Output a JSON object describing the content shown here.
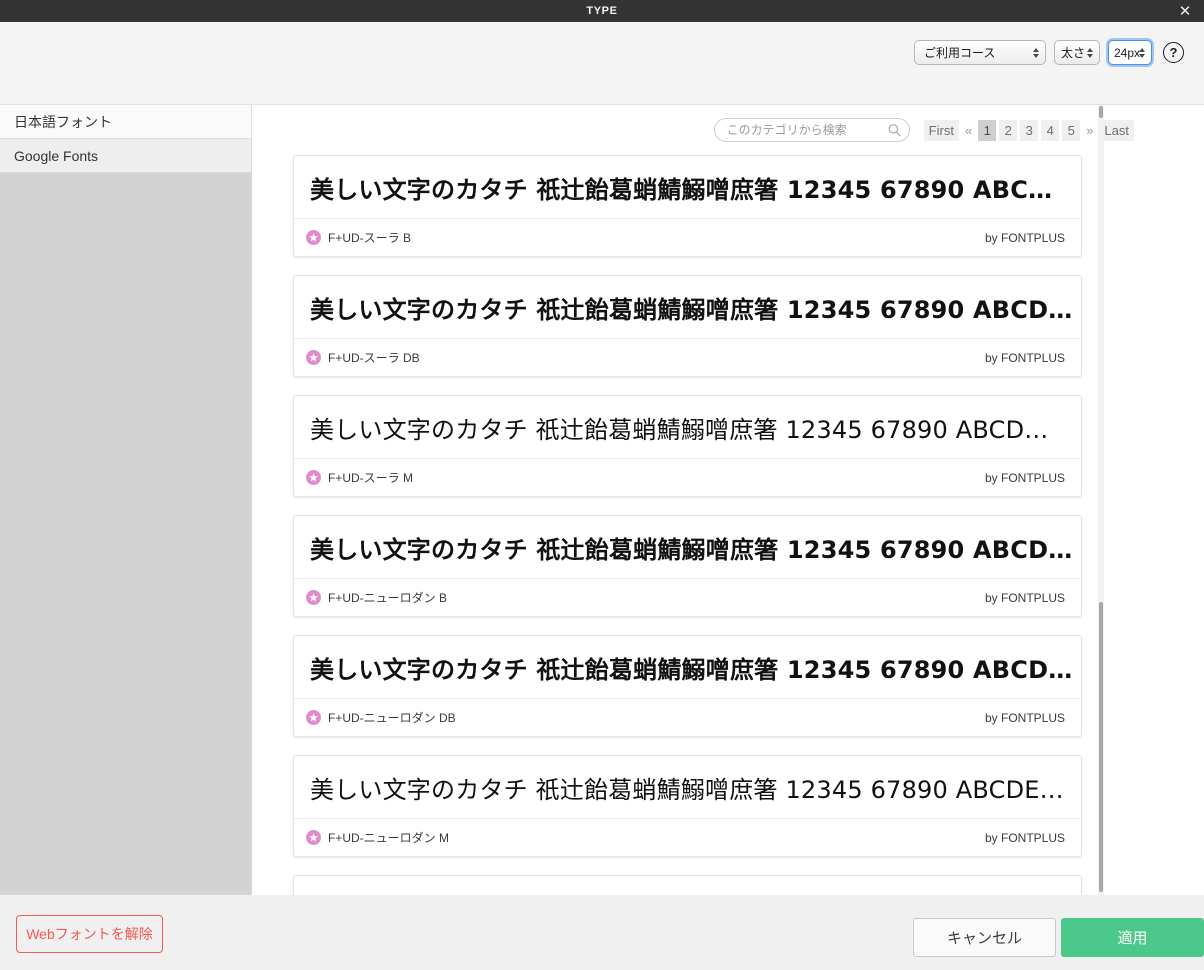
{
  "window": {
    "title": "TYPE",
    "close_label": "✕"
  },
  "toolbar": {
    "course_select": "ご利用コース",
    "weight_select": "太さ",
    "size_select": "24px",
    "help_label": "?"
  },
  "sidebar": {
    "items": [
      {
        "label": "日本語フォント",
        "selected": false
      },
      {
        "label": "Google Fonts",
        "selected": true
      }
    ]
  },
  "search": {
    "placeholder": "このカテゴリから検索",
    "value": ""
  },
  "pagination": {
    "first": "First",
    "prev": "«",
    "pages": [
      "1",
      "2",
      "3",
      "4",
      "5"
    ],
    "active": "1",
    "next": "»",
    "last": "Last"
  },
  "fonts": [
    {
      "sample": "美しい文字のカタチ 祇辻飴葛蛸鯖鰯噌庶箸 12345 67890 ABC…",
      "name": "F+UD-スーラ B",
      "vendor": "by FONTPLUS",
      "weight": "b"
    },
    {
      "sample": "美しい文字のカタチ 祇辻飴葛蛸鯖鰯噌庶箸 12345 67890 ABCD…",
      "name": "F+UD-スーラ DB",
      "vendor": "by FONTPLUS",
      "weight": "db"
    },
    {
      "sample": "美しい文字のカタチ 祇辻飴葛蛸鯖鰯噌庶箸 12345 67890 ABCD…",
      "name": "F+UD-スーラ M",
      "vendor": "by FONTPLUS",
      "weight": "m"
    },
    {
      "sample": "美しい文字のカタチ 祇辻飴葛蛸鯖鰯噌庶箸 12345 67890 ABCD…",
      "name": "F+UD-ニューロダン B",
      "vendor": "by FONTPLUS",
      "weight": "b"
    },
    {
      "sample": "美しい文字のカタチ 祇辻飴葛蛸鯖鰯噌庶箸 12345 67890 ABCD…",
      "name": "F+UD-ニューロダン DB",
      "vendor": "by FONTPLUS",
      "weight": "db"
    },
    {
      "sample": "美しい文字のカタチ 祇辻飴葛蛸鯖鰯噌庶箸 12345 67890 ABCDE…",
      "name": "F+UD-ニューロダン M",
      "vendor": "by FONTPLUS",
      "weight": "m"
    }
  ],
  "footer": {
    "release_label": "Webフォントを解除",
    "cancel_label": "キャンセル",
    "apply_label": "適用"
  },
  "colors": {
    "titlebar": "#333333",
    "apply": "#4cc98a",
    "release": "#f25a52",
    "star": "#e08bd0",
    "focus": "#4b90e2"
  }
}
